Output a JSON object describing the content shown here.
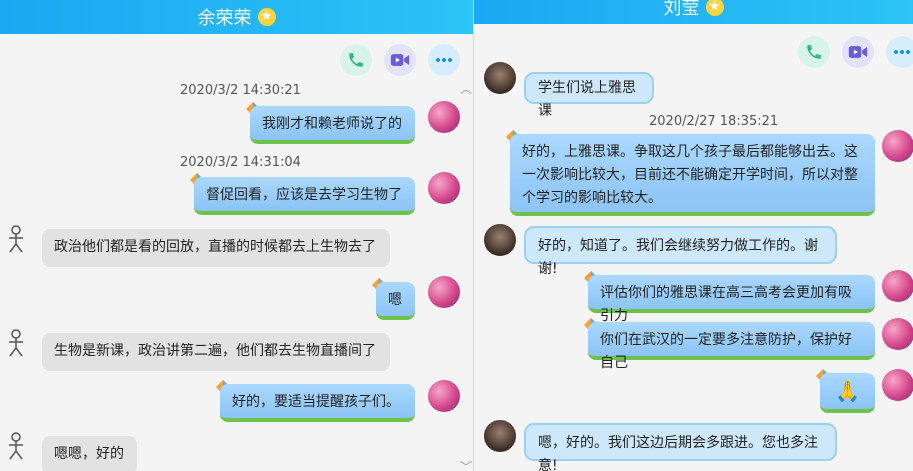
{
  "left": {
    "title": "余荣荣",
    "messages": [
      {
        "time": "2020/3/2 14:30:21"
      },
      {
        "text": "我刚才和赖老师说了的"
      },
      {
        "time": "2020/3/2 14:31:04"
      },
      {
        "text": "督促回看，应该是去学习生物了"
      },
      {
        "text": "政治他们都是看的回放，直播的时候都去上生物去了"
      },
      {
        "text": "嗯"
      },
      {
        "text": "生物是新课，政治讲第二遍，他们都去生物直播间了"
      },
      {
        "text": "好的，要适当提醒孩子们。"
      },
      {
        "text": "嗯嗯，好的"
      }
    ]
  },
  "right": {
    "title": "刘莹",
    "messages": [
      {
        "text": "学生们说上雅思课"
      },
      {
        "time": "2020/2/27 18:35:21"
      },
      {
        "text": "好的，上雅思课。争取这几个孩子最后都能够出去。这一次影响比较大，目前还不能确定开学时间，所以对整个学习的影响比较大。"
      },
      {
        "text": "好的，知道了。我们会继续努力做工作的。谢谢!"
      },
      {
        "text": "评估你们的雅思课在高三高考会更加有吸引力"
      },
      {
        "text": "你们在武汉的一定要多注意防护，保护好自己"
      },
      {
        "text": "🙏"
      },
      {
        "text": "嗯，好的。我们这边后期会多跟进。您也多注意!"
      }
    ]
  },
  "icons": [
    "star-icon",
    "phone-icon",
    "video-icon",
    "more-icon",
    "kite-sticker-icon",
    "stick-figure-icon"
  ],
  "colors": {
    "titlebar": "#1aa8f2",
    "outgoing": "#9fd0fb",
    "incoming": "#e2e2e2",
    "accent_green": "#6dc24b"
  }
}
